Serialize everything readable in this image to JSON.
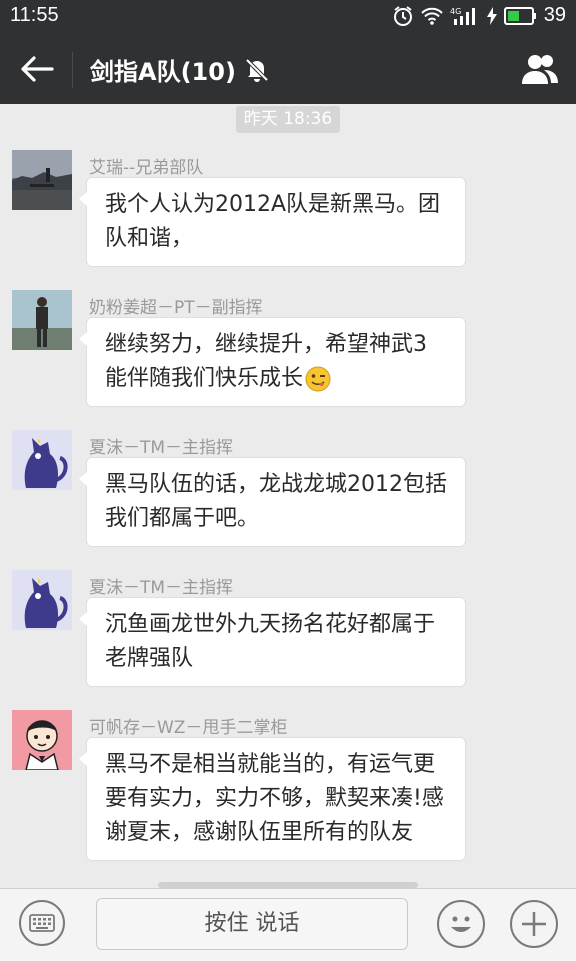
{
  "status": {
    "time": "11:55",
    "battery": "39"
  },
  "header": {
    "title": "剑指A队(10)"
  },
  "chat": {
    "timestamp": "昨天 18:36",
    "messages": [
      {
        "sender": "艾瑞--兄弟部队",
        "line1": "我个人认为2012A队是新黑马。团",
        "line2": "队和谐，"
      },
      {
        "sender": "奶粉姜超－PT－副指挥",
        "line1": "继续努力，继续提升，希望神武3",
        "line2": "能伴随我们快乐成长"
      },
      {
        "sender": "夏沫－TM－主指挥",
        "line1": "黑马队伍的话，龙战龙城2012包括",
        "line2": "我们都属于吧。"
      },
      {
        "sender": "夏沫－TM－主指挥",
        "line1": "沉鱼画龙世外九天扬名花好都属于",
        "line2": "老牌强队"
      },
      {
        "sender": "可帆存－WZ－甩手二掌柜",
        "line1": "黑马不是相当就能当的，有运气更",
        "line2": "要有实力，实力不够，默契来凑!感",
        "line3": "谢夏末，感谢队伍里所有的队友"
      }
    ]
  },
  "input": {
    "voice_label": "按住 说话"
  },
  "colors": {
    "header_bg": "#2f3133",
    "chat_bg": "#ebebeb",
    "battery_green": "#35c94a"
  },
  "icons": [
    "back-arrow-icon",
    "mute-bell-icon",
    "group-members-icon",
    "keyboard-icon",
    "emoji-face-icon",
    "plus-icon",
    "tongue-wink-emoji-icon"
  ]
}
